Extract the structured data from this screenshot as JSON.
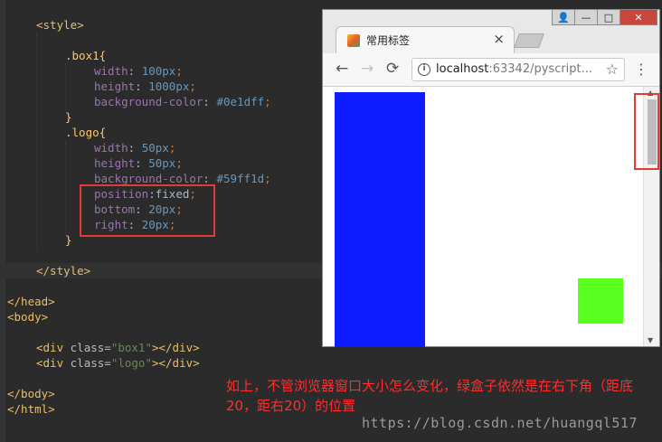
{
  "code": {
    "lines": [
      {
        "parts": [
          {
            "t": "<style>",
            "c": "tag"
          }
        ]
      },
      {
        "parts": []
      },
      {
        "parts": [
          {
            "t": ".box1{",
            "c": "sel"
          }
        ]
      },
      {
        "parts": [
          {
            "t": "width",
            "c": "prop"
          },
          {
            "t": ": ",
            "c": "val"
          },
          {
            "t": "100",
            "c": "num"
          },
          {
            "t": "px",
            "c": "num"
          },
          {
            "t": ";",
            "c": "punct"
          }
        ]
      },
      {
        "parts": [
          {
            "t": "height",
            "c": "prop"
          },
          {
            "t": ": ",
            "c": "val"
          },
          {
            "t": "1000",
            "c": "num"
          },
          {
            "t": "px",
            "c": "num"
          },
          {
            "t": ";",
            "c": "punct"
          }
        ]
      },
      {
        "parts": [
          {
            "t": "background-color",
            "c": "prop"
          },
          {
            "t": ": ",
            "c": "val"
          },
          {
            "t": "#0e1dff",
            "c": "num"
          },
          {
            "t": ";",
            "c": "punct"
          }
        ]
      },
      {
        "parts": [
          {
            "t": "}",
            "c": "sel"
          }
        ]
      },
      {
        "parts": [
          {
            "t": ".logo{",
            "c": "sel"
          }
        ]
      },
      {
        "parts": [
          {
            "t": "width",
            "c": "prop"
          },
          {
            "t": ": ",
            "c": "val"
          },
          {
            "t": "50",
            "c": "num"
          },
          {
            "t": "px",
            "c": "num"
          },
          {
            "t": ";",
            "c": "punct"
          }
        ]
      },
      {
        "parts": [
          {
            "t": "height",
            "c": "prop"
          },
          {
            "t": ": ",
            "c": "val"
          },
          {
            "t": "50",
            "c": "num"
          },
          {
            "t": "px",
            "c": "num"
          },
          {
            "t": ";",
            "c": "punct"
          }
        ]
      },
      {
        "parts": [
          {
            "t": "background-color",
            "c": "prop"
          },
          {
            "t": ": ",
            "c": "val"
          },
          {
            "t": "#59ff1d",
            "c": "num"
          },
          {
            "t": ";",
            "c": "punct"
          }
        ]
      },
      {
        "parts": [
          {
            "t": "position",
            "c": "prop"
          },
          {
            "t": ":",
            "c": "val"
          },
          {
            "t": "fixed",
            "c": "val"
          },
          {
            "t": ";",
            "c": "punct"
          }
        ]
      },
      {
        "parts": [
          {
            "t": "bottom",
            "c": "prop"
          },
          {
            "t": ": ",
            "c": "val"
          },
          {
            "t": "20",
            "c": "num"
          },
          {
            "t": "px",
            "c": "num"
          },
          {
            "t": ";",
            "c": "punct"
          }
        ]
      },
      {
        "parts": [
          {
            "t": "right",
            "c": "prop"
          },
          {
            "t": ": ",
            "c": "val"
          },
          {
            "t": "20",
            "c": "num"
          },
          {
            "t": "px",
            "c": "num"
          },
          {
            "t": ";",
            "c": "punct"
          }
        ]
      },
      {
        "parts": [
          {
            "t": "}",
            "c": "sel"
          }
        ]
      },
      {
        "parts": []
      },
      {
        "parts": [
          {
            "t": "</style>",
            "c": "tag"
          }
        ]
      },
      {
        "parts": []
      },
      {
        "parts": [
          {
            "t": "</head>",
            "c": "tag"
          }
        ]
      },
      {
        "parts": [
          {
            "t": "<body>",
            "c": "tag"
          }
        ]
      },
      {
        "parts": []
      },
      {
        "parts": [
          {
            "t": "<div ",
            "c": "tag"
          },
          {
            "t": "class",
            "c": "attr"
          },
          {
            "t": "=",
            "c": "val"
          },
          {
            "t": "\"box1\"",
            "c": "str"
          },
          {
            "t": "></div>",
            "c": "tag"
          }
        ]
      },
      {
        "parts": [
          {
            "t": "<div ",
            "c": "tag"
          },
          {
            "t": "class",
            "c": "attr"
          },
          {
            "t": "=",
            "c": "val"
          },
          {
            "t": "\"logo\"",
            "c": "str"
          },
          {
            "t": "></div>",
            "c": "tag"
          }
        ]
      },
      {
        "parts": []
      },
      {
        "parts": [
          {
            "t": "</body>",
            "c": "tag"
          }
        ]
      },
      {
        "parts": [
          {
            "t": "</html>",
            "c": "tag"
          }
        ]
      }
    ]
  },
  "browser": {
    "tab_title": "常用标签",
    "tab_close": "×",
    "back_icon": "←",
    "forward_icon": "→",
    "reload_icon": "⟳",
    "url_host": "localhost",
    "url_rest": ":63342/pyscript...",
    "star_icon": "☆",
    "menu_icon": "⋮",
    "info_icon": "i",
    "minimize_icon": "—",
    "maximize_icon": "□",
    "close_icon": "✕",
    "user_icon": "👤",
    "box1_color": "#0e1dff",
    "logo_color": "#59ff1d"
  },
  "annotation": {
    "text": "如上，不管浏览器窗口大小怎么变化，绿盒子依然是在右下角（距底20，距右20）的位置"
  },
  "watermark": "https://blog.csdn.net/huangql517"
}
